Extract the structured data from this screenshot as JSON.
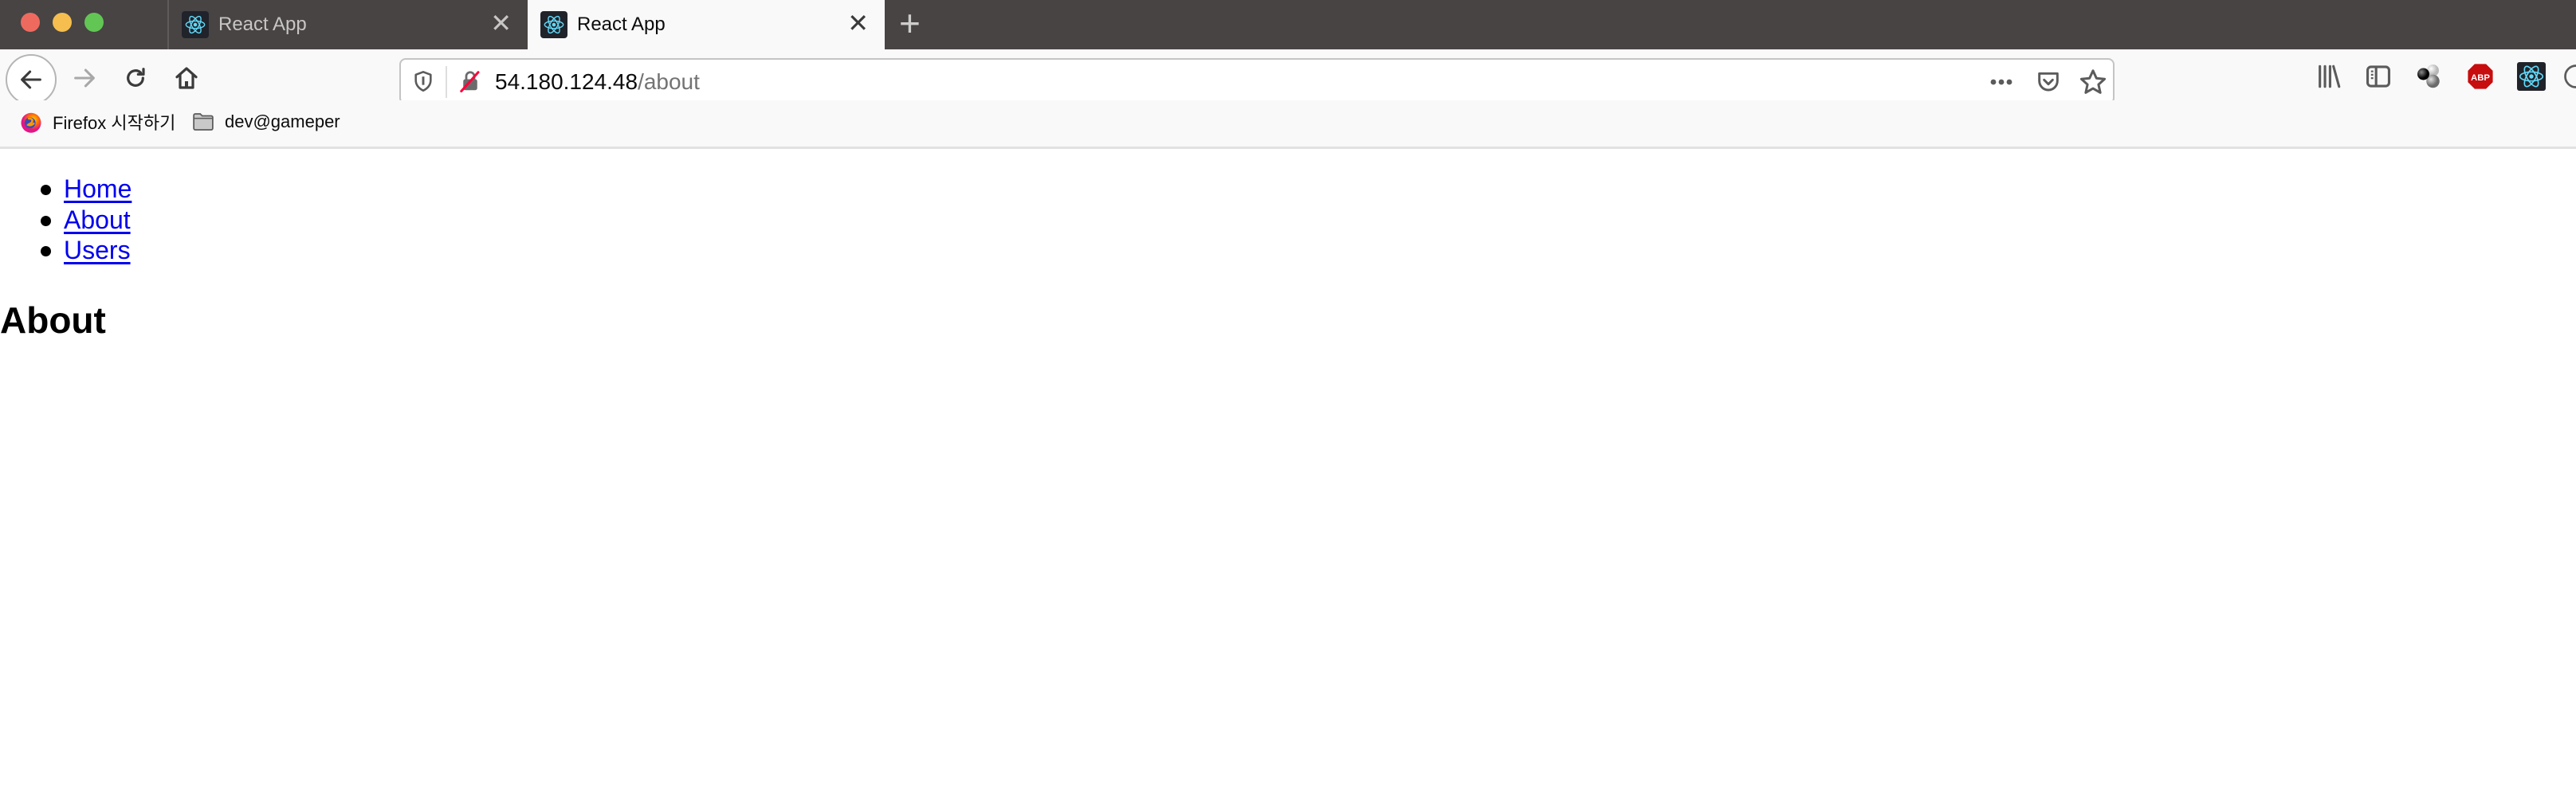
{
  "browser": {
    "tabs": [
      {
        "title": "React App",
        "active": false,
        "favicon": "react-icon"
      },
      {
        "title": "React App",
        "active": true,
        "favicon": "react-icon"
      }
    ],
    "new_tab_label": "+",
    "close_tab_glyph": "✕",
    "url": {
      "host": "54.180.124.48",
      "path": "/about"
    },
    "toolbar_icons": [
      "library-icon",
      "sidebar-icon",
      "molecule-extension-icon",
      "adblock-plus-icon",
      "react-devtools-icon",
      "overflow-icon"
    ],
    "abp_label": "ABP",
    "bookmarks": [
      {
        "label": "Firefox 시작하기",
        "icon": "firefox-icon"
      },
      {
        "label": "dev@gameper",
        "icon": "folder-icon"
      }
    ]
  },
  "page": {
    "nav_links": [
      {
        "label": "Home"
      },
      {
        "label": "About"
      },
      {
        "label": "Users"
      }
    ],
    "heading": "About"
  },
  "colors": {
    "link": "#0000ee",
    "tabstrip": "#474443",
    "toolbar": "#f9f9fa",
    "react_blue": "#61dafb",
    "abp_red": "#c70d0e"
  }
}
